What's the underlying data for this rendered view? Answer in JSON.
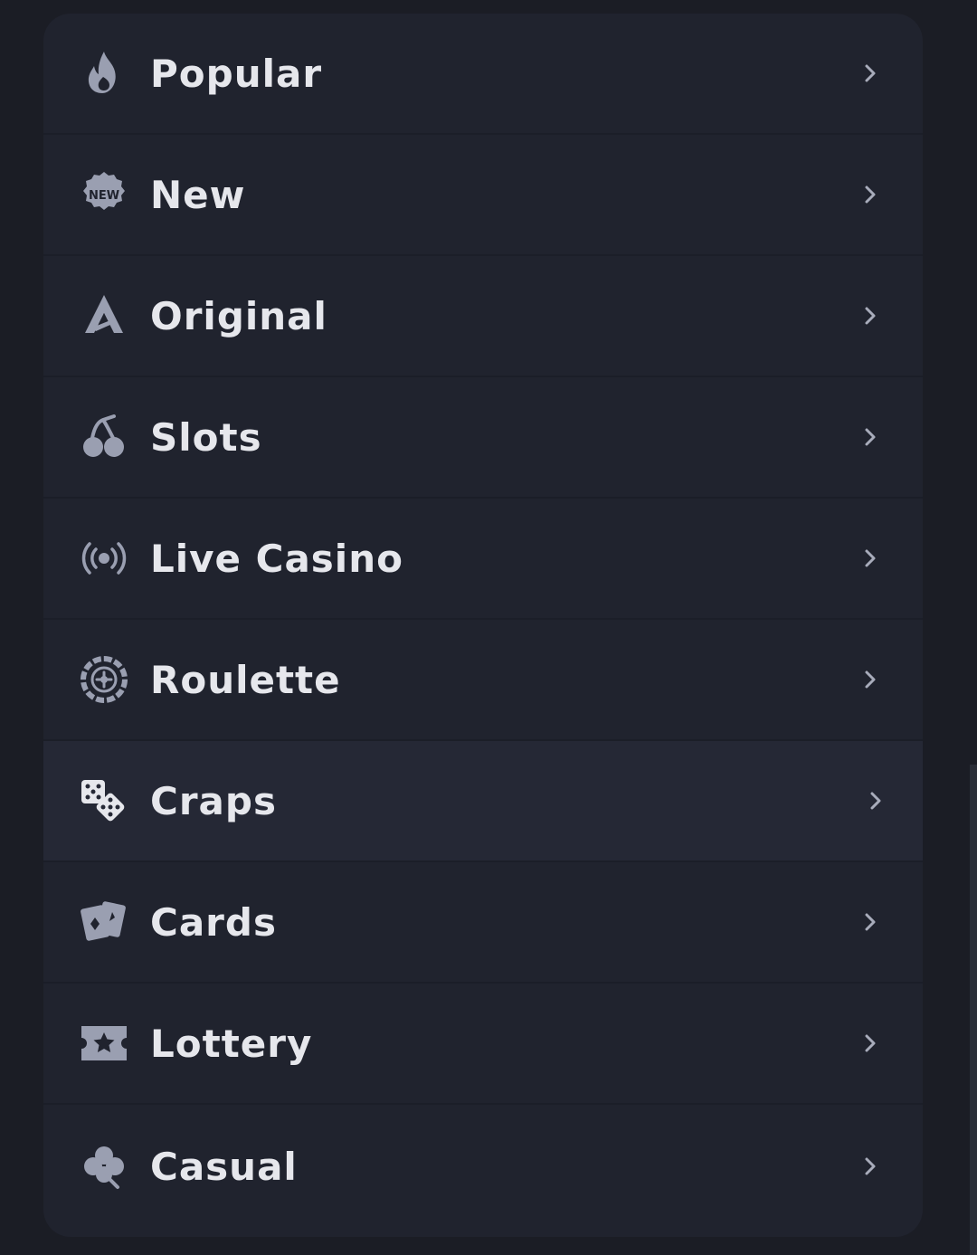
{
  "menu": {
    "items": [
      {
        "label": "Popular",
        "icon": "flame-icon"
      },
      {
        "label": "New",
        "icon": "new-badge-icon"
      },
      {
        "label": "Original",
        "icon": "original-logo-icon"
      },
      {
        "label": "Slots",
        "icon": "cherries-icon"
      },
      {
        "label": "Live Casino",
        "icon": "broadcast-icon"
      },
      {
        "label": "Roulette",
        "icon": "roulette-wheel-icon"
      },
      {
        "label": "Craps",
        "icon": "dice-icon"
      },
      {
        "label": "Cards",
        "icon": "playing-cards-icon"
      },
      {
        "label": "Lottery",
        "icon": "ticket-star-icon"
      },
      {
        "label": "Casual",
        "icon": "clover-icon"
      }
    ],
    "active_index": 6
  },
  "colors": {
    "background": "#1b1d25",
    "panel": "#20232e",
    "active_row": "#252835",
    "text": "#e6e7ec",
    "icon": "#9a9fb1"
  }
}
